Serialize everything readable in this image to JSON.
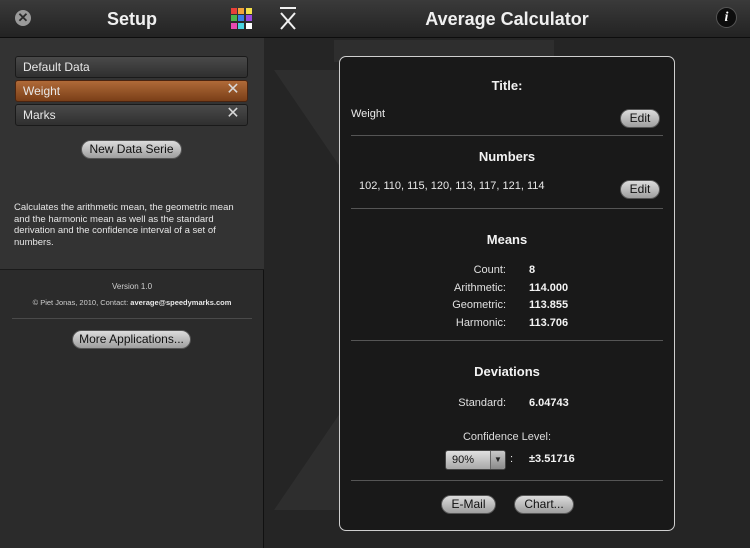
{
  "sidebar": {
    "title": "Setup",
    "items": [
      {
        "label": "Default Data"
      },
      {
        "label": "Weight"
      },
      {
        "label": "Marks"
      }
    ],
    "new_button": "New Data Serie",
    "description": "Calculates the arithmetic mean, the geometric mean and the harmonic mean as well as the standard derivation and the confidence interval of a set of numbers.",
    "version": "Version 1.0",
    "copyright_prefix": "© Piet Jonas, 2010, Contact:",
    "contact_email": "average@speedymarks.com",
    "more_button": "More Applications..."
  },
  "main": {
    "title": "Average Calculator",
    "info_glyph": "i",
    "title_section": {
      "heading": "Title:",
      "value": "Weight",
      "edit": "Edit"
    },
    "numbers_section": {
      "heading": "Numbers",
      "value": "102, 110, 115, 120, 113, 117, 121, 114",
      "edit": "Edit"
    },
    "means": {
      "heading": "Means",
      "rows": [
        {
          "label": "Count:",
          "value": "8"
        },
        {
          "label": "Arithmetic:",
          "value": "114.000"
        },
        {
          "label": "Geometric:",
          "value": "113.855"
        },
        {
          "label": "Harmonic:",
          "value": "113.706"
        }
      ]
    },
    "deviations": {
      "heading": "Deviations",
      "standard_label": "Standard:",
      "standard_value": "6.04743",
      "confidence_label": "Confidence Level:",
      "confidence_selected": "90%",
      "confidence_sep": ":",
      "confidence_value": "±3.51716"
    },
    "email_button": "E-Mail",
    "chart_button": "Chart..."
  },
  "icons": {
    "close": "close-icon",
    "palette": "color-grid-icon",
    "xbar": "x-bar-icon",
    "info": "info-icon",
    "remove": "remove-x-icon",
    "dropdown": "chevron-down-icon"
  },
  "colors": {
    "selected_item": "#9a5428",
    "palette": [
      "#e8403a",
      "#f2a43a",
      "#f4e14a",
      "#4cb64a",
      "#3a7ee8",
      "#9b4ae0",
      "#e84ab0",
      "#4ad4e0",
      "#ffffff"
    ]
  }
}
